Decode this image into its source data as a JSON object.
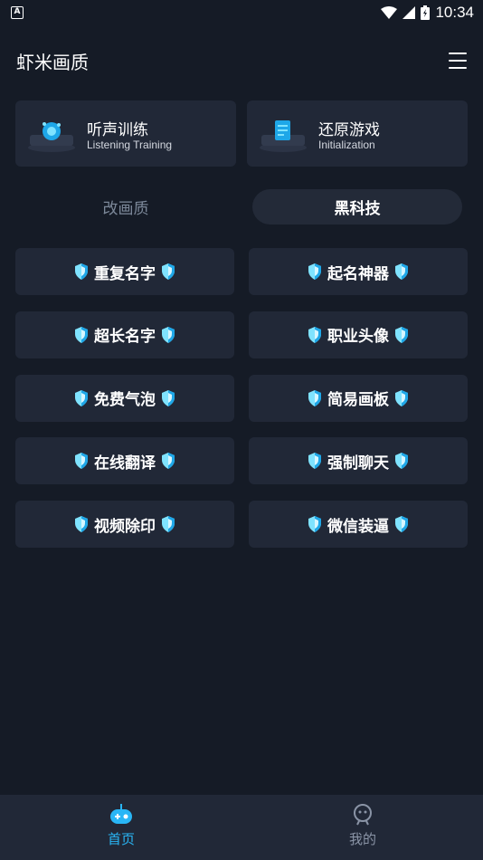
{
  "status_bar": {
    "notification_letter": "A",
    "time": "10:34"
  },
  "header": {
    "title": "虾米画质"
  },
  "top_cards": [
    {
      "title": "听声训练",
      "subtitle": "Listening Training"
    },
    {
      "title": "还原游戏",
      "subtitle": "Initialization"
    }
  ],
  "tabs": [
    {
      "label": "改画质",
      "active": false
    },
    {
      "label": "黑科技",
      "active": true
    }
  ],
  "tools": [
    "重复名字",
    "起名神器",
    "超长名字",
    "职业头像",
    "免费气泡",
    "简易画板",
    "在线翻译",
    "强制聊天",
    "视频除印",
    "微信装逼"
  ],
  "bottom_nav": [
    {
      "label": "首页",
      "icon": "gamepad-icon",
      "active": true
    },
    {
      "label": "我的",
      "icon": "user-icon",
      "active": false
    }
  ],
  "colors": {
    "background": "#151b26",
    "card": "#212837",
    "accent": "#29b6f6",
    "muted": "#7c8899"
  }
}
